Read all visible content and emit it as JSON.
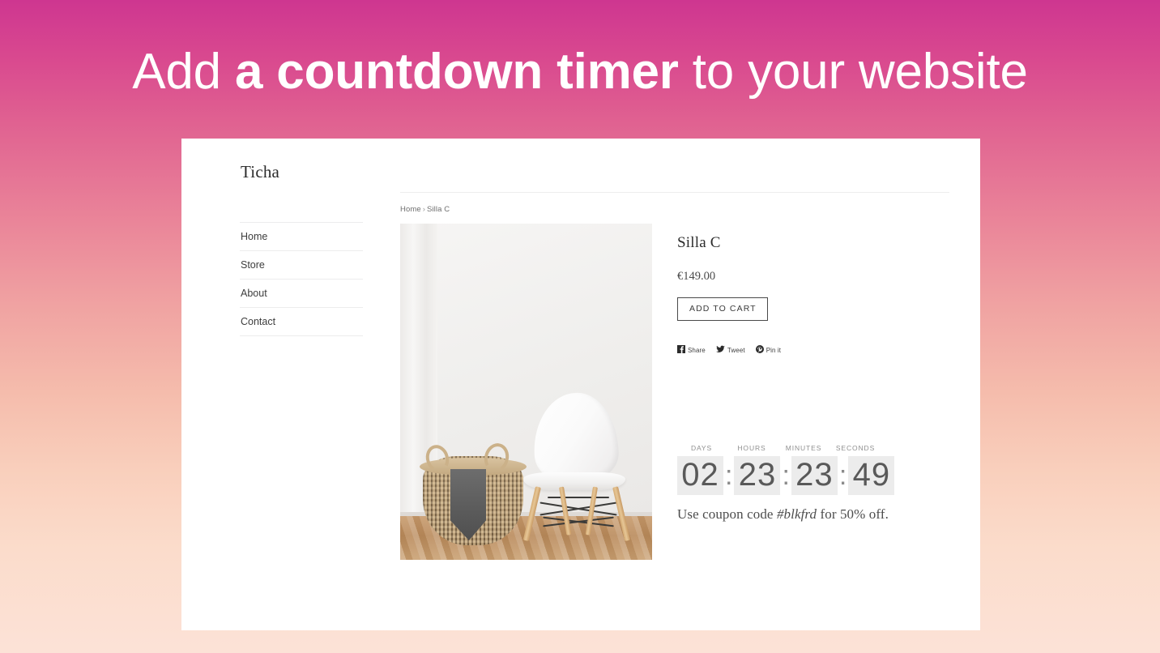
{
  "headline": {
    "part1": "Add ",
    "strong": "a countdown timer",
    "part2": " to your website"
  },
  "theme": {
    "gradient_top": "#ce3690",
    "gradient_mid": "#f0a3a2",
    "gradient_bottom": "#fce2d7",
    "card_bg": "#ffffff",
    "digit_bg": "#ececec",
    "digit_color": "#595959"
  },
  "site": {
    "logo": "Ticha",
    "nav": [
      {
        "label": "Home"
      },
      {
        "label": "Store"
      },
      {
        "label": "About"
      },
      {
        "label": "Contact"
      }
    ],
    "breadcrumb": {
      "home": "Home",
      "separator": "›",
      "current": "Silla C"
    },
    "product": {
      "image_alt": "white chair and woven basket",
      "title": "Silla C",
      "price": "€149.00",
      "add_to_cart_label": "ADD TO CART",
      "share": [
        {
          "icon": "facebook-icon",
          "label": "Share"
        },
        {
          "icon": "twitter-icon",
          "label": "Tweet"
        },
        {
          "icon": "pinterest-icon",
          "label": "Pin it"
        }
      ]
    },
    "countdown": {
      "labels": {
        "days": "DAYS",
        "hours": "HOURS",
        "minutes": "MINUTES",
        "seconds": "SECONDS"
      },
      "values": {
        "days": "02",
        "hours": "23",
        "minutes": "23",
        "seconds": "49"
      },
      "separator": ":"
    },
    "coupon": {
      "prefix": "Use coupon code ",
      "code": "#blkfrd",
      "suffix": " for 50% off."
    }
  }
}
